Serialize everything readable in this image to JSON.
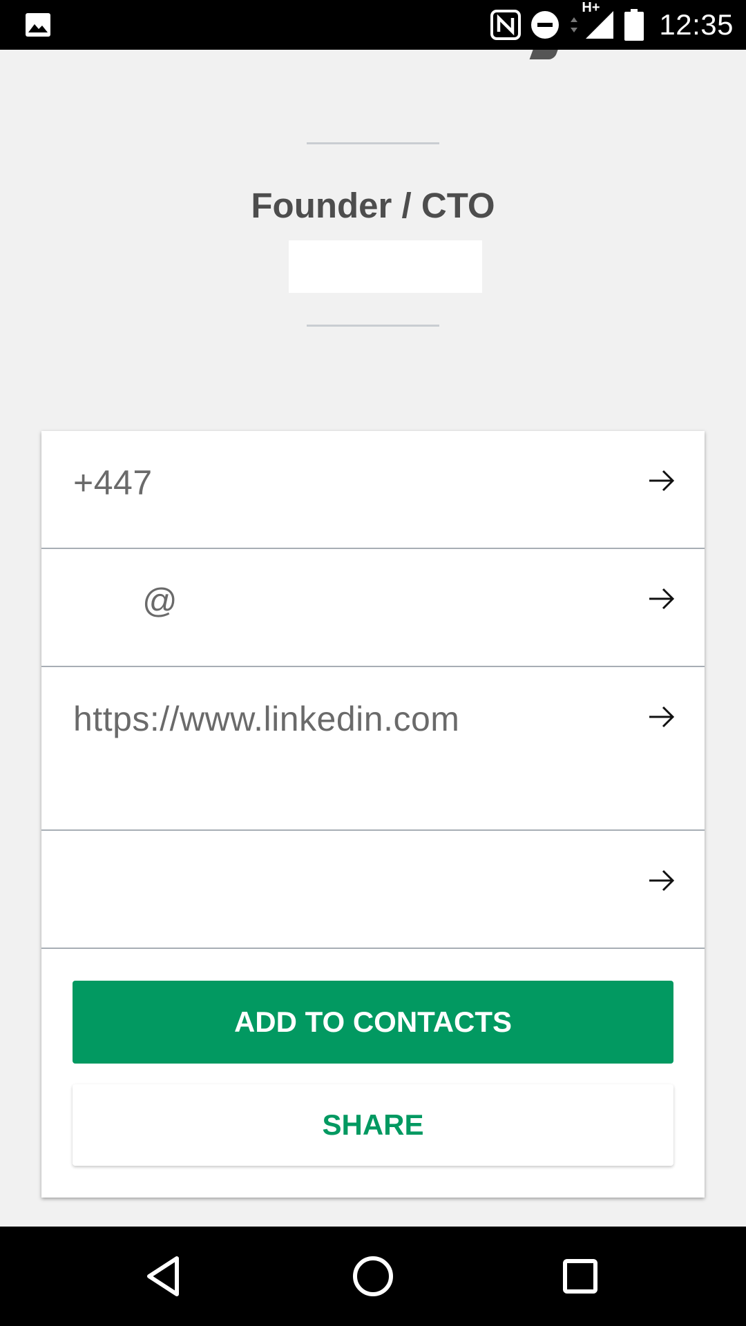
{
  "status_bar": {
    "icons": [
      "image-notification-icon",
      "nfc-icon",
      "do-not-disturb-icon",
      "data-arrows-icon",
      "hplus-signal-icon",
      "battery-icon"
    ],
    "network_type": "H+",
    "time": "12:35"
  },
  "profile": {
    "job_title": "Founder / CTO",
    "company": ""
  },
  "contact_rows": [
    {
      "type": "phone",
      "value": "+447",
      "icon": "arrow-right-icon"
    },
    {
      "type": "email",
      "value": "@",
      "icon": "arrow-right-icon"
    },
    {
      "type": "linkedin",
      "value": "https://www.linkedin.com",
      "icon": "arrow-right-icon"
    },
    {
      "type": "other",
      "value": "",
      "icon": "arrow-right-icon"
    }
  ],
  "actions": {
    "add_to_contacts": "ADD TO CONTACTS",
    "share": "SHARE"
  },
  "colors": {
    "accent": "#029961",
    "background": "#f1f1f1",
    "title_text": "#4d4d4d"
  },
  "nav_bar": {
    "buttons": [
      "back-icon",
      "home-icon",
      "recent-apps-icon"
    ]
  }
}
